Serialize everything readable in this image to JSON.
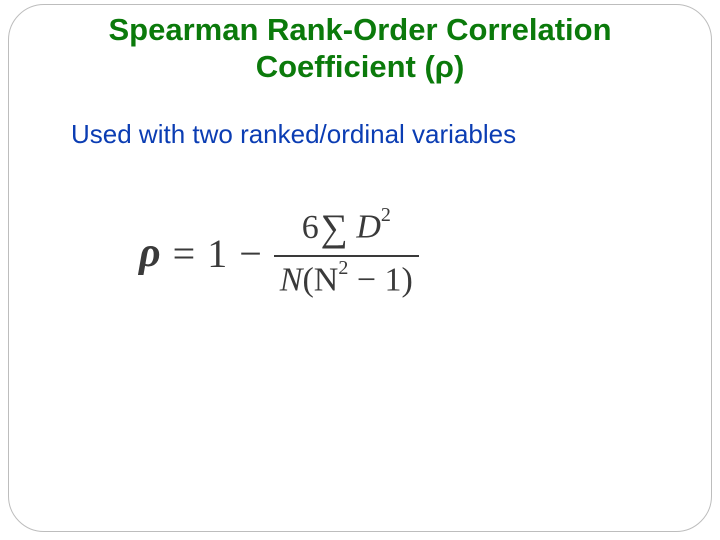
{
  "title_line1": "Spearman Rank-Order Correlation",
  "title_line2": "Coefficient (ρ)",
  "subtitle": "Used with two ranked/ordinal variables",
  "formula": {
    "latex": "\\rho = 1 - \\frac{6 \\sum D^{2}}{N(N^{2} - 1)}",
    "lhs": "ρ",
    "eq": "=",
    "one": "1",
    "minus": "−",
    "num_six": "6",
    "num_sigma": "∑",
    "num_D": "D",
    "num_exp": "2",
    "den_N1": "N",
    "den_open": "(",
    "den_N2": "N",
    "den_exp": "2",
    "den_minus": "−",
    "den_one": "1",
    "den_close": ")"
  }
}
